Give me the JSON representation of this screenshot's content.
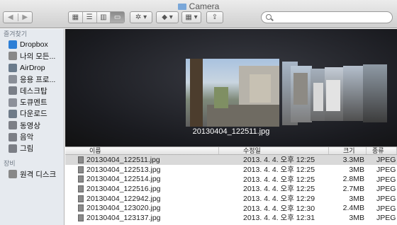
{
  "window": {
    "title": "Camera"
  },
  "toolbar": {
    "nav": [
      "◀",
      "▶"
    ],
    "views": [
      "▦",
      "☰",
      "▥",
      "▭"
    ],
    "gear": "✲ ▾",
    "dropbox": "◆ ▾",
    "arrange": "▦ ▾",
    "share": "⇪",
    "search_placeholder": ""
  },
  "sidebar": {
    "favorites_header": "즐겨찾기",
    "favorites": [
      {
        "label": "Dropbox",
        "icon": "dropbox-icon",
        "color": "#2d7fd6"
      },
      {
        "label": "나의 모든...",
        "icon": "all-files-icon",
        "color": "#888888"
      },
      {
        "label": "AirDrop",
        "icon": "airdrop-icon",
        "color": "#6a7b8c"
      },
      {
        "label": "응용 프로...",
        "icon": "applications-icon",
        "color": "#8a8f98"
      },
      {
        "label": "데스크탑",
        "icon": "desktop-icon",
        "color": "#7a7f88"
      },
      {
        "label": "도큐멘트",
        "icon": "documents-icon",
        "color": "#8c9099"
      },
      {
        "label": "다운로드",
        "icon": "downloads-icon",
        "color": "#6e7a88"
      },
      {
        "label": "동영상",
        "icon": "movies-icon",
        "color": "#7c7f86"
      },
      {
        "label": "음악",
        "icon": "music-icon",
        "color": "#7c7f86"
      },
      {
        "label": "그림",
        "icon": "pictures-icon",
        "color": "#7c7f86"
      }
    ],
    "devices_header": "장비",
    "devices": [
      {
        "label": "원격 디스크",
        "icon": "remote-disc-icon",
        "color": "#888888"
      }
    ]
  },
  "coverflow": {
    "caption": "20130404_122511.jpg"
  },
  "list": {
    "headers": {
      "name": "이름",
      "date": "수정일",
      "size": "크기",
      "kind": "종류"
    },
    "rows": [
      {
        "name": "20130404_122511.jpg",
        "date": "2013. 4. 4. 오후 12:25",
        "size": "3.3MB",
        "kind": "JPEG 이미지"
      },
      {
        "name": "20130404_122513.jpg",
        "date": "2013. 4. 4. 오후 12:25",
        "size": "3MB",
        "kind": "JPEG 이미지"
      },
      {
        "name": "20130404_122514.jpg",
        "date": "2013. 4. 4. 오후 12:25",
        "size": "2.8MB",
        "kind": "JPEG 이미지"
      },
      {
        "name": "20130404_122516.jpg",
        "date": "2013. 4. 4. 오후 12:25",
        "size": "2.7MB",
        "kind": "JPEG 이미지"
      },
      {
        "name": "20130404_122942.jpg",
        "date": "2013. 4. 4. 오후 12:29",
        "size": "3MB",
        "kind": "JPEG 이미지"
      },
      {
        "name": "20130404_123020.jpg",
        "date": "2013. 4. 4. 오후 12:30",
        "size": "2.4MB",
        "kind": "JPEG 이미지"
      },
      {
        "name": "20130404_123137.jpg",
        "date": "2013. 4. 4. 오후 12:31",
        "size": "3MB",
        "kind": "JPEG 이미지"
      }
    ]
  }
}
